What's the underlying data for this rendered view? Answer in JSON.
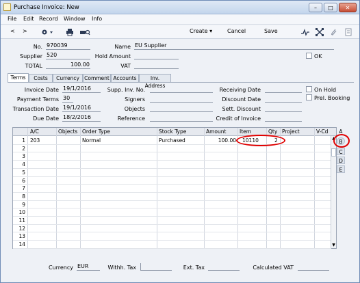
{
  "window": {
    "title": "Purchase Invoice: New",
    "controls": [
      "–",
      "□",
      "✕"
    ]
  },
  "menu": [
    "File",
    "Edit",
    "Record",
    "Window",
    "Info"
  ],
  "toolbar": {
    "nav_prev": "<",
    "nav_next": ">",
    "create": "Create",
    "cancel": "Cancel",
    "save": "Save"
  },
  "header": {
    "no_label": "No.",
    "no_value": "970039",
    "supplier_label": "Supplier",
    "supplier_value": "520",
    "total_label": "TOTAL",
    "total_value": "100.00",
    "name_label": "Name",
    "name_value": "EU Supplier",
    "hold_label": "Hold Amount",
    "hold_value": "",
    "vat_label": "VAT",
    "vat_value": "",
    "ok_label": "OK"
  },
  "tabs": [
    "Terms",
    "Costs",
    "Currency",
    "Comment",
    "Accounts",
    "Inv. Address"
  ],
  "terms": {
    "invoice_date_label": "Invoice Date",
    "invoice_date": "19/1/2016",
    "payment_terms_label": "Payment Terms",
    "payment_terms": "30",
    "transaction_date_label": "Transaction Date",
    "transaction_date": "19/1/2016",
    "due_date_label": "Due Date",
    "due_date": "18/2/2016",
    "supp_inv_label": "Supp. Inv. No.",
    "signers_label": "Signers",
    "objects_label": "Objects",
    "reference_label": "Reference",
    "receiving_date_label": "Receiving Date",
    "discount_date_label": "Discount Date",
    "sett_discount_label": "Sett. Discount",
    "credit_label": "Credit of Invoice",
    "on_hold_label": "On Hold",
    "prel_booking_label": "Prel. Booking"
  },
  "grid": {
    "columns": [
      "A/C",
      "Objects",
      "Order Type",
      "Stock Type",
      "Amount",
      "Item",
      "Qty",
      "Project",
      "V-Cd"
    ],
    "row_numbers": [
      "1",
      "2",
      "3",
      "4",
      "5",
      "6",
      "7",
      "8",
      "9",
      "10",
      "11",
      "12",
      "13",
      "14"
    ],
    "row1": {
      "ac": "203",
      "objects": "",
      "order_type": "Normal",
      "stock_type": "Purchased",
      "amount": "100.00",
      "item": "10110",
      "qty": "2"
    }
  },
  "side_tabs": [
    "A",
    "B",
    "C",
    "D",
    "E"
  ],
  "footer": {
    "currency_label": "Currency",
    "currency_value": "EUR",
    "withh_label": "Withh. Tax",
    "ext_label": "Ext. Tax",
    "calc_vat_label": "Calculated VAT"
  },
  "colors": {
    "highlight": "#e00000",
    "frame": "#6d8ab5"
  }
}
